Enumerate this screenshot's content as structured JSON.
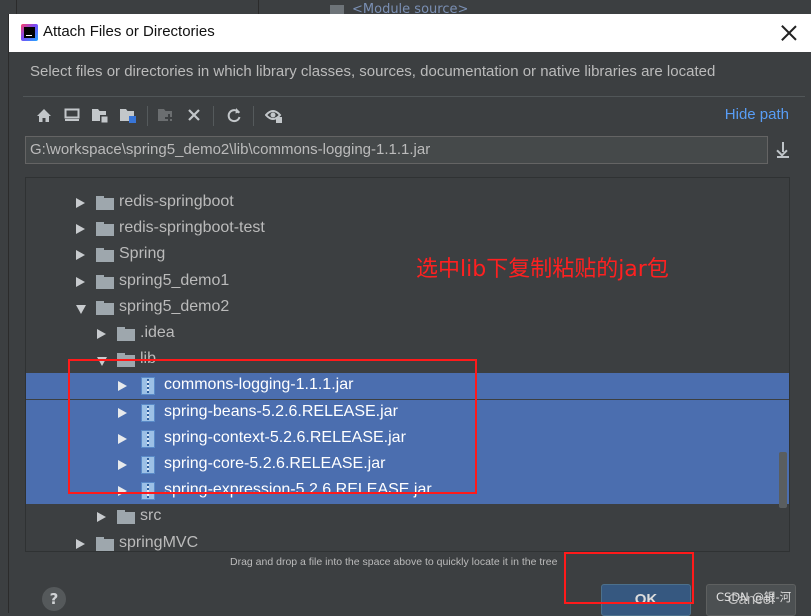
{
  "background": {
    "module_label": "<Module source>"
  },
  "dialog": {
    "title": "Attach Files or Directories",
    "description": "Select files or directories in which library classes, sources, documentation or native libraries are located",
    "hide_path": "Hide path",
    "path_value": "G:\\workspace\\spring5_demo2\\lib\\commons-logging-1.1.1.jar",
    "toolbar_icons": [
      "home-icon",
      "desktop-icon",
      "project-icon",
      "module-icon",
      "new-folder-icon",
      "delete-icon",
      "refresh-icon",
      "show-hidden-icon"
    ],
    "tree": [
      {
        "label": "redis-springboot",
        "type": "folder",
        "expanded": false,
        "level": 0,
        "selected": false
      },
      {
        "label": "redis-springboot-test",
        "type": "folder",
        "expanded": false,
        "level": 0,
        "selected": false
      },
      {
        "label": "Spring",
        "type": "folder",
        "expanded": false,
        "level": 0,
        "selected": false
      },
      {
        "label": "spring5_demo1",
        "type": "folder",
        "expanded": false,
        "level": 0,
        "selected": false
      },
      {
        "label": "spring5_demo2",
        "type": "folder",
        "expanded": true,
        "level": 0,
        "selected": false
      },
      {
        "label": ".idea",
        "type": "folder",
        "expanded": false,
        "level": 1,
        "selected": false
      },
      {
        "label": "lib",
        "type": "folder",
        "expanded": true,
        "level": 1,
        "selected": false
      },
      {
        "label": "commons-logging-1.1.1.jar",
        "type": "jar",
        "expanded": false,
        "level": 2,
        "selected": true
      },
      {
        "label": "spring-beans-5.2.6.RELEASE.jar",
        "type": "jar",
        "expanded": false,
        "level": 2,
        "selected": true
      },
      {
        "label": "spring-context-5.2.6.RELEASE.jar",
        "type": "jar",
        "expanded": false,
        "level": 2,
        "selected": true
      },
      {
        "label": "spring-core-5.2.6.RELEASE.jar",
        "type": "jar",
        "expanded": false,
        "level": 2,
        "selected": true
      },
      {
        "label": "spring-expression-5.2.6.RELEASE.jar",
        "type": "jar",
        "expanded": false,
        "level": 2,
        "selected": true
      },
      {
        "label": "src",
        "type": "folder",
        "expanded": false,
        "level": 1,
        "selected": false
      },
      {
        "label": "springMVC",
        "type": "folder",
        "expanded": false,
        "level": 0,
        "selected": false
      }
    ],
    "annotation": "选中lib下复制粘贴的jar包",
    "drag_hint": "Drag and drop a file into the space above to quickly locate it in the tree",
    "help_label": "?",
    "ok_label": "OK",
    "cancel_label": "Cancel"
  },
  "watermark": "CSDN @银-河",
  "colors": {
    "selection": "#4b6eaf",
    "annotation_red": "#ff2020",
    "link_blue": "#589df6",
    "panel": "#3c3f41"
  }
}
